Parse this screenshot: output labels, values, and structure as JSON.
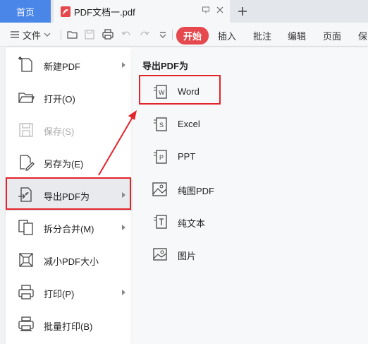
{
  "titlebar": {
    "home_tab": "首页",
    "doc_tab": "PDF文档一.pdf"
  },
  "toolbar": {
    "file_menu": "文件",
    "tabs": [
      "开始",
      "插入",
      "批注",
      "编辑",
      "页面",
      "保"
    ]
  },
  "menu": {
    "items": [
      {
        "label": "新建PDF",
        "icon": "new-pdf-icon",
        "submenu": true
      },
      {
        "label": "打开(O)",
        "icon": "folder-open-icon",
        "submenu": false
      },
      {
        "label": "保存(S)",
        "icon": "save-icon",
        "submenu": false,
        "disabled": true
      },
      {
        "label": "另存为(E)",
        "icon": "save-as-icon",
        "submenu": false
      },
      {
        "label": "导出PDF为",
        "icon": "export-pdf-icon",
        "submenu": true,
        "highlighted": true
      },
      {
        "label": "拆分合并(M)",
        "icon": "split-merge-icon",
        "submenu": true
      },
      {
        "label": "减小PDF大小",
        "icon": "compress-icon",
        "submenu": false
      },
      {
        "label": "打印(P)",
        "icon": "print-icon",
        "submenu": true
      },
      {
        "label": "批量打印(B)",
        "icon": "batch-print-icon",
        "submenu": false
      }
    ]
  },
  "submenu": {
    "title": "导出PDF为",
    "items": [
      {
        "label": "Word",
        "icon": "word-icon"
      },
      {
        "label": "Excel",
        "icon": "excel-icon"
      },
      {
        "label": "PPT",
        "icon": "ppt-icon"
      },
      {
        "label": "纯图PDF",
        "icon": "image-pdf-icon"
      },
      {
        "label": "纯文本",
        "icon": "text-icon"
      },
      {
        "label": "图片",
        "icon": "picture-icon"
      }
    ]
  },
  "colors": {
    "accent_blue": "#4a86e8",
    "accent_red": "#e5484d",
    "highlight_box": "#e3242b"
  }
}
